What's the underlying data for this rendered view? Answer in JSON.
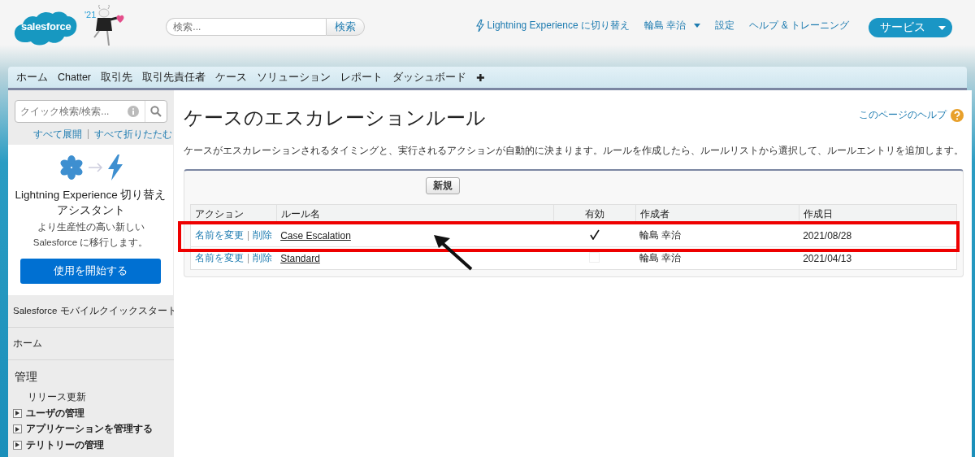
{
  "header": {
    "logo": "salesforce",
    "release_badge": "'21",
    "search": {
      "placeholder": "検索...",
      "button": "検索"
    },
    "links": [
      {
        "kind": "lightning",
        "label": "Lightning Experience に切り替え"
      },
      {
        "kind": "user",
        "label": "輪島 幸治"
      },
      {
        "kind": "plain",
        "label": "設定"
      },
      {
        "kind": "plain",
        "label": "ヘルプ & トレーニング"
      }
    ],
    "app_menu": "サービス"
  },
  "tabs": [
    {
      "label": "ホーム"
    },
    {
      "label": "Chatter"
    },
    {
      "label": "取引先"
    },
    {
      "label": "取引先責任者"
    },
    {
      "label": "ケース"
    },
    {
      "label": "ソリューション"
    },
    {
      "label": "レポート"
    },
    {
      "label": "ダッシュボード"
    },
    {
      "label": "✚"
    }
  ],
  "sidebar": {
    "quick_search": {
      "placeholder": "クイック検索/検索..."
    },
    "expand_all": "すべて展開",
    "separator": "|",
    "collapse_all": "すべて折りたたむ",
    "promo": {
      "title": "Lightning Experience 切り替えアシスタント",
      "text": "より生産性の高い新しい Salesforce に移行します。",
      "button": "使用を開始する"
    },
    "sections": [
      {
        "label": "Salesforce モバイルクイックスタート"
      },
      {
        "label": "ホーム"
      }
    ],
    "admin": {
      "title": "管理",
      "items": [
        {
          "kind": "leaf",
          "label": "リリース更新"
        },
        {
          "kind": "folder",
          "label": "ユーザの管理",
          "expanded": false
        },
        {
          "kind": "folder",
          "label": "アプリケーションを管理する",
          "expanded": false
        },
        {
          "kind": "folder",
          "label": "テリトリーの管理",
          "expanded": false
        }
      ]
    }
  },
  "main": {
    "title": "ケースのエスカレーションルール",
    "help_link": "このページのヘルプ",
    "description": "ケースがエスカレーションされるタイミングと、実行されるアクションが自動的に決まります。ルールを作成したら、ルールリストから選択して、ルールエントリを追加します。",
    "new_button": "新規",
    "table": {
      "columns": [
        "アクション",
        "ルール名",
        "有効",
        "作成者",
        "作成日"
      ],
      "rows": [
        {
          "rename": "名前を変更",
          "separator": "|",
          "delete": "削除",
          "name": "Case Escalation",
          "active": true,
          "created_by": "輪島 幸治",
          "created_on": "2021/08/28",
          "highlighted": true
        },
        {
          "rename": "名前を変更",
          "separator": "|",
          "delete": "削除",
          "name": "Standard",
          "active": false,
          "created_by": "輪島 幸治",
          "created_on": "2021/04/13",
          "highlighted": false
        }
      ]
    }
  }
}
